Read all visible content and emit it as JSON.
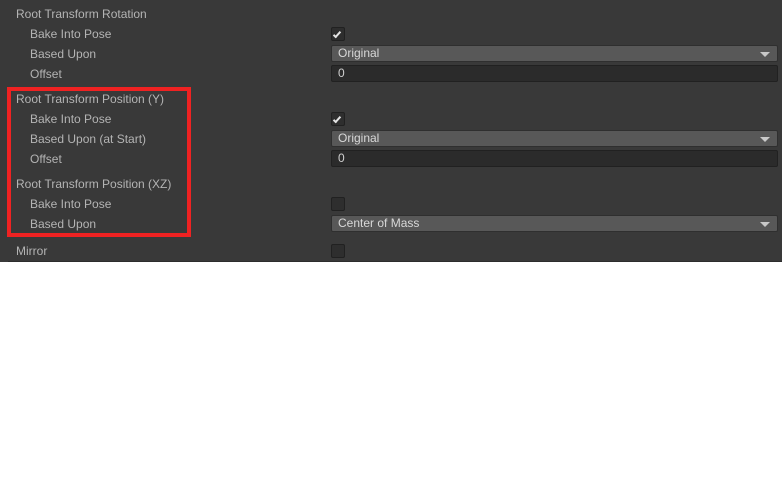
{
  "panel": {
    "background_color": "#393939",
    "label_color": "#b4b4b4",
    "dropdown_color": "#585858",
    "field_color": "#2b2b2b"
  },
  "annotation": {
    "color": "#ef2222",
    "shape": "rectangle"
  },
  "sections": [
    {
      "title": "Root Transform Rotation",
      "rows": [
        {
          "label": "Bake Into Pose",
          "control": "checkbox",
          "checked": true
        },
        {
          "label": "Based Upon",
          "control": "dropdown",
          "value": "Original"
        },
        {
          "label": "Offset",
          "control": "field",
          "value": "0"
        }
      ]
    },
    {
      "title": "Root Transform Position (Y)",
      "rows": [
        {
          "label": "Bake Into Pose",
          "control": "checkbox",
          "checked": true
        },
        {
          "label": "Based Upon (at Start)",
          "control": "dropdown",
          "value": "Original"
        },
        {
          "label": "Offset",
          "control": "field",
          "value": "0"
        }
      ]
    },
    {
      "title": "Root Transform Position (XZ)",
      "rows": [
        {
          "label": "Bake Into Pose",
          "control": "checkbox",
          "checked": false
        },
        {
          "label": "Based Upon",
          "control": "dropdown",
          "value": "Center of Mass"
        }
      ]
    }
  ],
  "mirror": {
    "label": "Mirror",
    "checked": false
  },
  "icons": {
    "chevron": "chevron-down-icon",
    "check": "checkmark-icon"
  }
}
